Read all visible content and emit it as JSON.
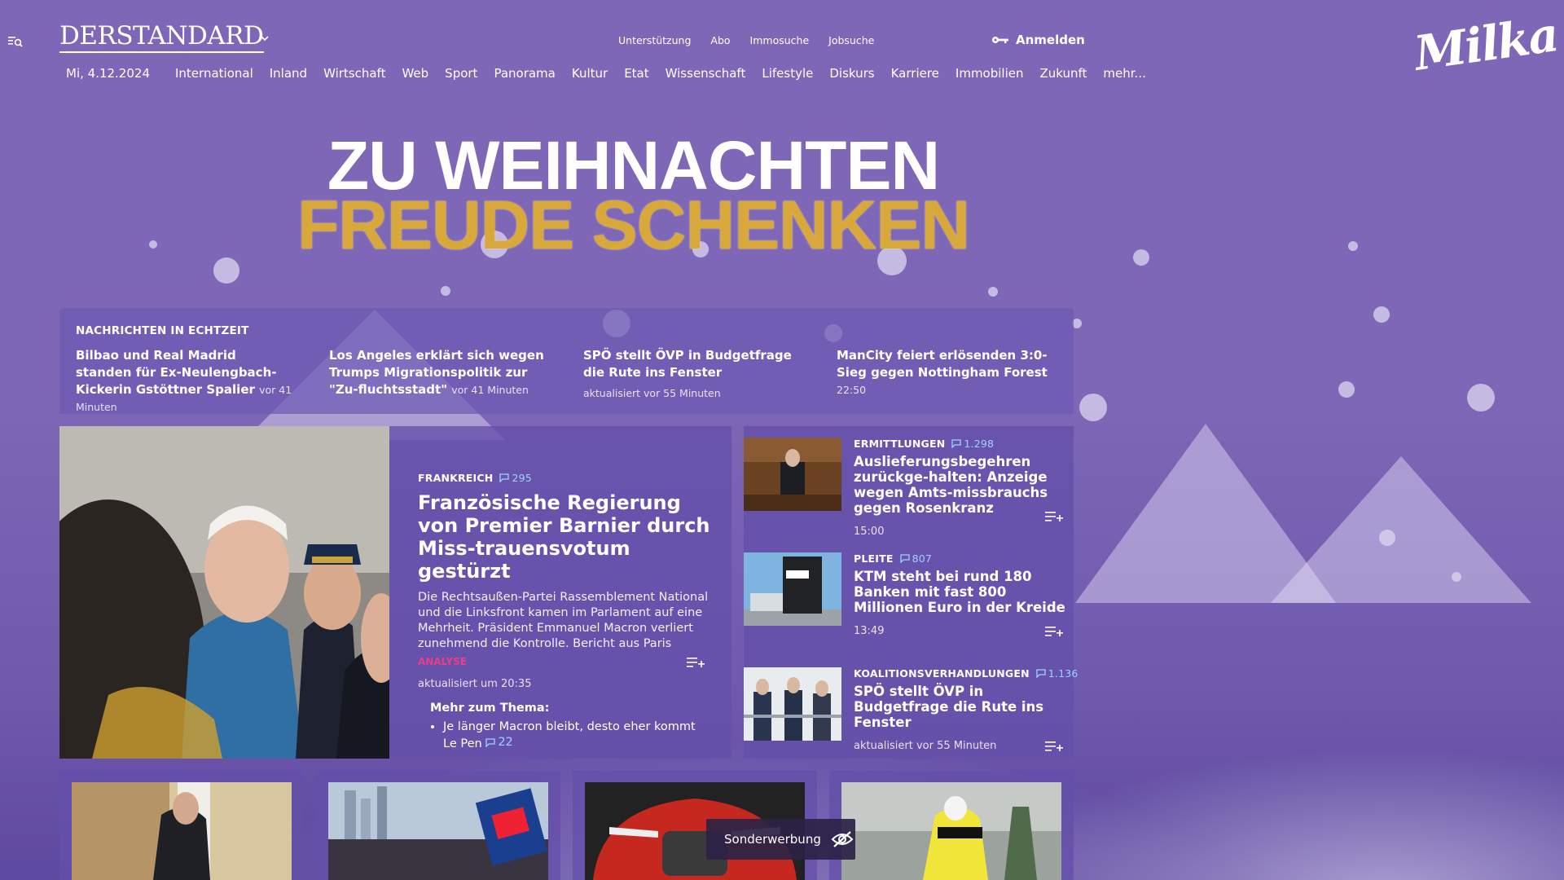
{
  "header": {
    "logo": "DERSTANDARD",
    "util_links": [
      "Unterstützung",
      "Abo",
      "Immosuche",
      "Jobsuche"
    ],
    "login_label": "Anmelden",
    "sponsor": "Milka"
  },
  "nav": {
    "date": "Mi, 4.12.2024",
    "items": [
      "International",
      "Inland",
      "Wirtschaft",
      "Web",
      "Sport",
      "Panorama",
      "Kultur",
      "Etat",
      "Wissenschaft",
      "Lifestyle",
      "Diskurs",
      "Karriere",
      "Immobilien",
      "Zukunft",
      "mehr..."
    ]
  },
  "ad": {
    "line1": "ZU WEIHNACHTEN",
    "line2": "FREUDE SCHENKEN"
  },
  "ticker": {
    "title": "NACHRICHTEN IN ECHTZEIT",
    "items": [
      {
        "title": "Bilbao und Real Madrid standen für Ex-Neulengbach-Kickerin Gstöttner Spalier",
        "time": "vor 41 Minuten"
      },
      {
        "title": "Los Angeles erklärt sich wegen Trumps Migrationspolitik zur \"Zu-fluchtsstadt\"",
        "time": "vor 41 Minuten"
      },
      {
        "title": "SPÖ stellt ÖVP in Budgetfrage die Rute ins Fenster",
        "time": "aktualisiert vor 55 Minuten"
      },
      {
        "title": "ManCity feiert erlösenden 3:0-Sieg gegen Nottingham Forest",
        "time": "22:50"
      }
    ]
  },
  "lead": {
    "kicker": "FRANKREICH",
    "comments": "295",
    "title": "Französische Regierung von Premier Barnier durch Miss-trauensvotum gestürzt",
    "teaser": "Die Rechtsaußen-Partei Rassemblement National und die Linksfront kamen im Parlament auf eine Mehrheit. Präsident Emmanuel Macron verliert zunehmend die Kontrolle. Bericht aus Paris",
    "tag": "ANALYSE",
    "meta": "aktualisiert um 20:35",
    "more_title": "Mehr zum Thema:",
    "more_item": "Je länger Macron bleibt, desto eher kommt Le Pen",
    "more_comments": "22"
  },
  "side": [
    {
      "kicker": "ERMITTLUNGEN",
      "comments": "1.298",
      "title": "Auslieferungsbegehren zurückge-halten: Anzeige wegen Amts-missbrauchs gegen Rosenkranz",
      "meta": "15:00"
    },
    {
      "kicker": "PLEITE",
      "comments": "807",
      "title": "KTM steht bei rund 180 Banken mit fast 800 Millionen Euro in der Kreide",
      "meta": "13:49"
    },
    {
      "kicker": "KOALITIONSVERHANDLUNGEN",
      "comments": "1.136",
      "title": "SPÖ stellt ÖVP in Budgetfrage die Rute ins Fenster",
      "meta": "aktualisiert vor 55 Minuten"
    }
  ],
  "ad_label": "Sonderwerbung",
  "colors": {
    "background": "#7d67b6",
    "gold": "#d8a93a",
    "comment_blue": "#9fd3ff",
    "analysis_pink": "#e83e8c"
  }
}
